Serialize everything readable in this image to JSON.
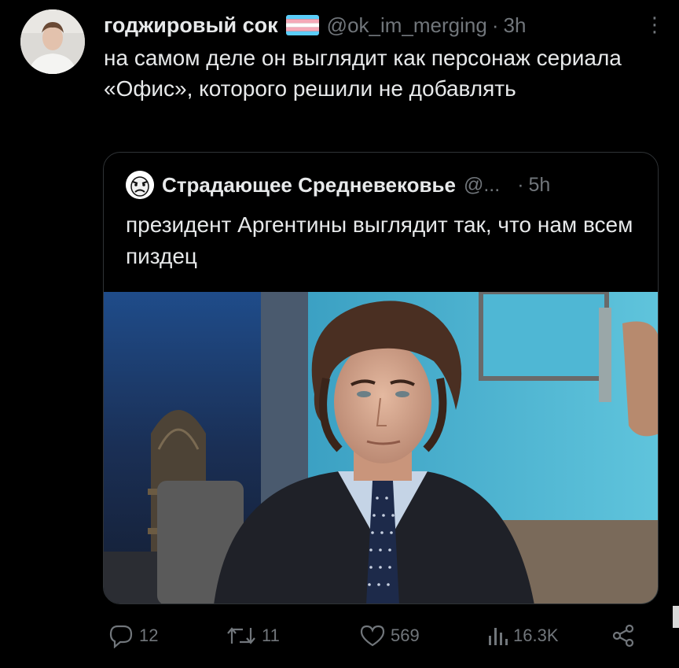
{
  "tweet": {
    "author_name": "годжировый сок",
    "author_handle": "@ok_im_merging",
    "separator": "·",
    "time": "3h",
    "more_label": "⋮",
    "text": "на самом деле он выглядит как персонаж сериала «Офис», которого решили не добавлять"
  },
  "quoted_tweet": {
    "author_name": "Страдающее Средневековье",
    "author_handle": "@...",
    "separator": "·",
    "time": "5h",
    "text": "президент Аргентины выглядит так, что нам всем пиздец"
  },
  "actions": {
    "reply_count": "12",
    "retweet_count": "11",
    "like_count": "569",
    "views_count": "16.3K"
  },
  "icons": {
    "reply": "reply-icon",
    "retweet": "retweet-icon",
    "like": "heart-icon",
    "views": "views-icon",
    "share": "share-icon"
  },
  "colors": {
    "background": "#000000",
    "text": "#e7e9ea",
    "secondary": "#71767b",
    "border": "#2f3336"
  }
}
